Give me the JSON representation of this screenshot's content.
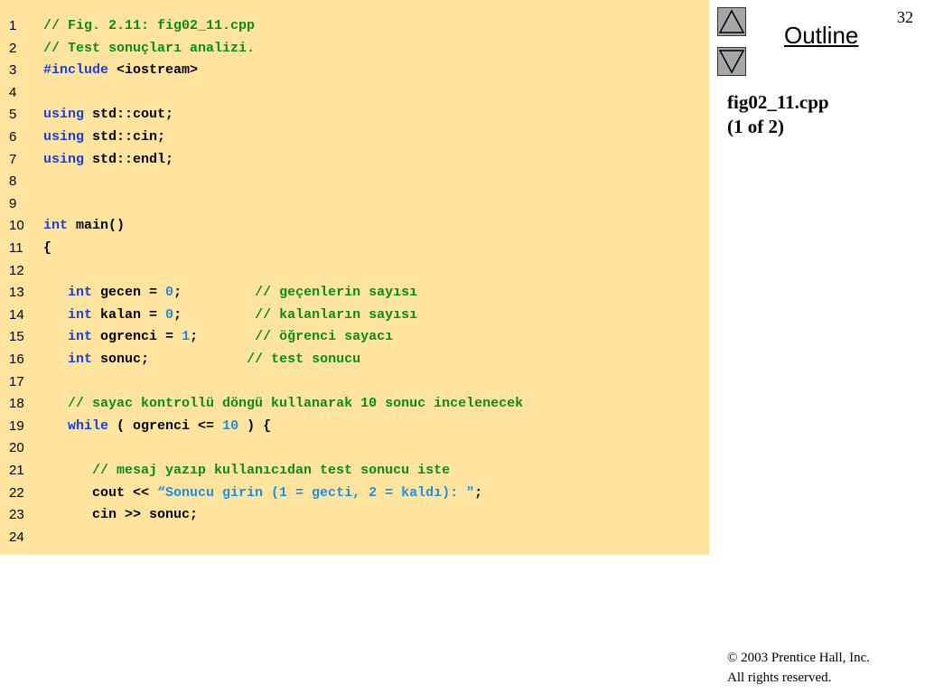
{
  "slide": {
    "page_number": "32",
    "outline_label": "Outline",
    "file_title_line1": "fig02_11.cpp",
    "file_title_line2": "(1 of 2)",
    "copyright_line1": "© 2003 Prentice Hall, Inc.",
    "copyright_line2": "All rights reserved."
  },
  "nav": {
    "up_icon": "triangle-up-icon",
    "down_icon": "triangle-down-icon"
  },
  "colors": {
    "code_background": "#ffe4a0",
    "keyword": "#1a3fd6",
    "comment": "#0b8a1e",
    "literal": "#1e8fe0",
    "nav_button": "#a6a6a6"
  },
  "code": {
    "lines": [
      {
        "n": "1",
        "tokens": [
          {
            "t": "// Fig. 2.11: fig02_11.cpp",
            "c": "cm"
          }
        ]
      },
      {
        "n": "2",
        "tokens": [
          {
            "t": "// Test sonuçları analizi.",
            "c": "cm"
          }
        ]
      },
      {
        "n": "3",
        "tokens": [
          {
            "t": "#include",
            "c": "kw"
          },
          {
            "t": " <iostream>",
            "c": "id"
          }
        ]
      },
      {
        "n": "4",
        "tokens": []
      },
      {
        "n": "5",
        "tokens": [
          {
            "t": "using",
            "c": "kw"
          },
          {
            "t": " std::cout;",
            "c": "id"
          }
        ]
      },
      {
        "n": "6",
        "tokens": [
          {
            "t": "using",
            "c": "kw"
          },
          {
            "t": " std::cin;",
            "c": "id"
          }
        ]
      },
      {
        "n": "7",
        "tokens": [
          {
            "t": "using",
            "c": "kw"
          },
          {
            "t": " std::endl;",
            "c": "id"
          }
        ]
      },
      {
        "n": "8",
        "tokens": []
      },
      {
        "n": "9",
        "tokens": []
      },
      {
        "n": "10",
        "tokens": [
          {
            "t": "int",
            "c": "kw"
          },
          {
            "t": " main()",
            "c": "id"
          }
        ]
      },
      {
        "n": "11",
        "tokens": [
          {
            "t": "{",
            "c": "id"
          }
        ]
      },
      {
        "n": "12",
        "tokens": []
      },
      {
        "n": "13",
        "tokens": [
          {
            "t": "   ",
            "c": "id"
          },
          {
            "t": "int",
            "c": "kw"
          },
          {
            "t": " gecen = ",
            "c": "id"
          },
          {
            "t": "0",
            "c": "num"
          },
          {
            "t": ";         ",
            "c": "id"
          },
          {
            "t": "// geçenlerin sayısı",
            "c": "cm"
          }
        ]
      },
      {
        "n": "14",
        "tokens": [
          {
            "t": "   ",
            "c": "id"
          },
          {
            "t": "int",
            "c": "kw"
          },
          {
            "t": " kalan = ",
            "c": "id"
          },
          {
            "t": "0",
            "c": "num"
          },
          {
            "t": ";         ",
            "c": "id"
          },
          {
            "t": "// kalanların sayısı",
            "c": "cm"
          }
        ]
      },
      {
        "n": "15",
        "tokens": [
          {
            "t": "   ",
            "c": "id"
          },
          {
            "t": "int",
            "c": "kw"
          },
          {
            "t": " ogrenci = ",
            "c": "id"
          },
          {
            "t": "1",
            "c": "num"
          },
          {
            "t": ";       ",
            "c": "id"
          },
          {
            "t": "// öğrenci sayacı",
            "c": "cm"
          }
        ]
      },
      {
        "n": "16",
        "tokens": [
          {
            "t": "   ",
            "c": "id"
          },
          {
            "t": "int",
            "c": "kw"
          },
          {
            "t": " sonuc;            ",
            "c": "id"
          },
          {
            "t": "// test sonucu",
            "c": "cm"
          }
        ]
      },
      {
        "n": "17",
        "tokens": []
      },
      {
        "n": "18",
        "tokens": [
          {
            "t": "   ",
            "c": "id"
          },
          {
            "t": "// sayac kontrollü döngü kullanarak 10 sonuc incelenecek",
            "c": "cm"
          }
        ]
      },
      {
        "n": "19",
        "tokens": [
          {
            "t": "   ",
            "c": "id"
          },
          {
            "t": "while",
            "c": "kw"
          },
          {
            "t": " ( ogrenci <= ",
            "c": "id"
          },
          {
            "t": "10",
            "c": "num"
          },
          {
            "t": " ) {",
            "c": "id"
          }
        ]
      },
      {
        "n": "20",
        "tokens": []
      },
      {
        "n": "21",
        "tokens": [
          {
            "t": "      ",
            "c": "id"
          },
          {
            "t": "// mesaj yazıp kullanıcıdan test sonucu iste",
            "c": "cm"
          }
        ]
      },
      {
        "n": "22",
        "tokens": [
          {
            "t": "      cout << ",
            "c": "id"
          },
          {
            "t": "“Sonucu girin (1 = gecti, 2 = kaldı): \"",
            "c": "str"
          },
          {
            "t": ";",
            "c": "id"
          }
        ]
      },
      {
        "n": "23",
        "tokens": [
          {
            "t": "      cin >> sonuc;",
            "c": "id"
          }
        ]
      },
      {
        "n": "24",
        "tokens": []
      }
    ]
  }
}
